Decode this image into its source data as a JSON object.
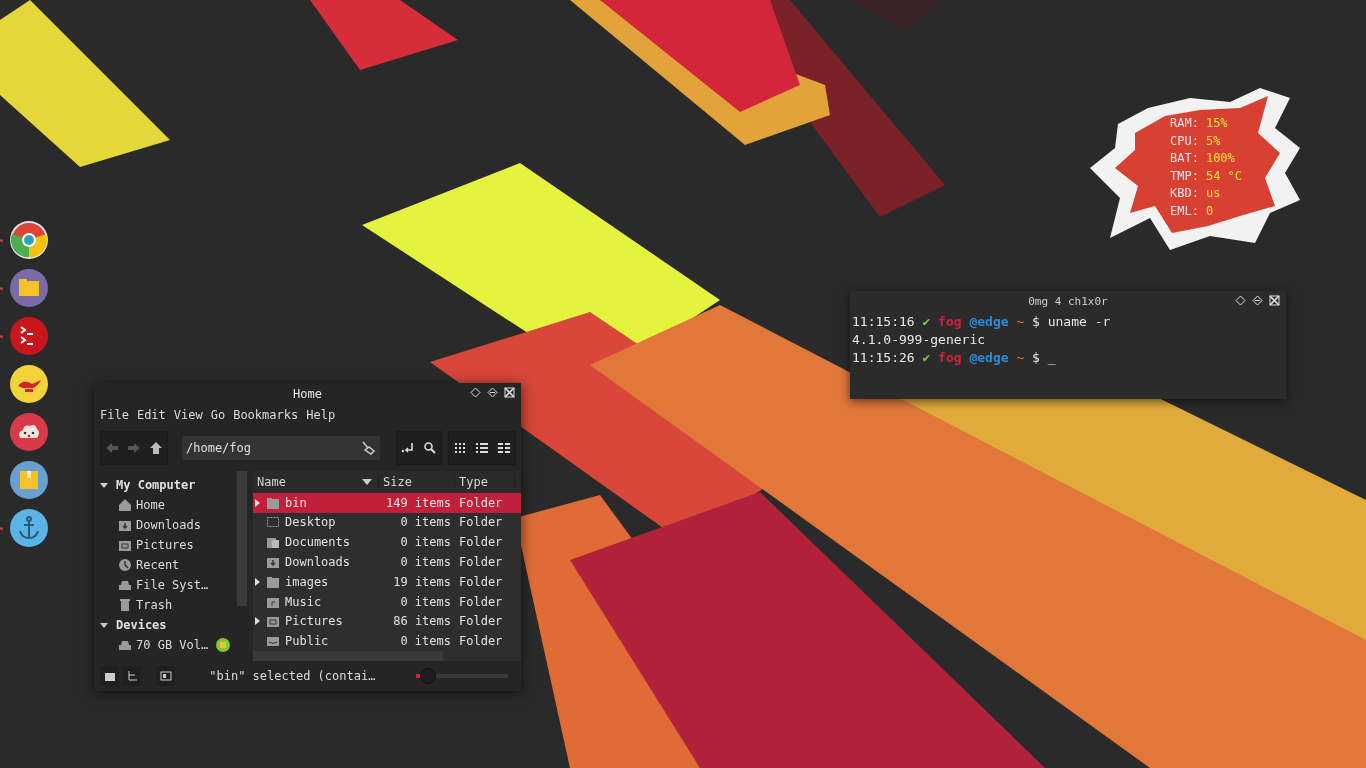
{
  "dock": [
    {
      "kind": "browser",
      "running": true
    },
    {
      "kind": "files",
      "running": true
    },
    {
      "kind": "terminal",
      "running": true
    },
    {
      "kind": "lamp",
      "running": false
    },
    {
      "kind": "cloud",
      "running": false
    },
    {
      "kind": "package",
      "running": false
    },
    {
      "kind": "anchor",
      "running": true
    }
  ],
  "system_monitor": [
    {
      "label": "RAM:",
      "value": "15%"
    },
    {
      "label": "CPU:",
      "value": "5%"
    },
    {
      "label": "BAT:",
      "value": "100%"
    },
    {
      "label": "TMP:",
      "value": "54 °C"
    },
    {
      "label": "KBD:",
      "value": "us"
    },
    {
      "label": "EML:",
      "value": "0"
    }
  ],
  "terminal": {
    "title": "0mg 4 ch1x0r",
    "lines": [
      {
        "kind": "prompt",
        "time": "11:15:16",
        "check": "✔",
        "user": "fog",
        "host": "@edge",
        "path": "~",
        "symbol": "$",
        "command": "uname -r"
      },
      {
        "kind": "output",
        "text": "4.1.0-999-generic"
      },
      {
        "kind": "prompt",
        "time": "11:15:26",
        "check": "✔",
        "user": "fog",
        "host": "@edge",
        "path": "~",
        "symbol": "$",
        "command": "_"
      }
    ]
  },
  "file_manager": {
    "title": "Home",
    "menu": [
      "File",
      "Edit",
      "View",
      "Go",
      "Bookmarks",
      "Help"
    ],
    "location": "/home/fog",
    "sidebar": [
      {
        "heading": "My Computer",
        "expanded": true,
        "items": [
          {
            "label": "Home",
            "kind": "home"
          },
          {
            "label": "Downloads",
            "kind": "download"
          },
          {
            "label": "Pictures",
            "kind": "picture"
          },
          {
            "label": "Recent",
            "kind": "recent"
          },
          {
            "label": "File Syst…",
            "kind": "drive"
          },
          {
            "label": "Trash",
            "kind": "trash"
          }
        ]
      },
      {
        "heading": "Devices",
        "expanded": true,
        "items": [
          {
            "label": "70 GB Vol…",
            "kind": "drive"
          }
        ]
      }
    ],
    "columns": [
      "Name",
      "Size",
      "Type"
    ],
    "rows": [
      {
        "name": "bin",
        "size": "149 items",
        "type": "Folder",
        "selected": true,
        "expandable": true,
        "kind": "folder"
      },
      {
        "name": "Desktop",
        "size": "0 items",
        "type": "Folder",
        "selected": false,
        "expandable": false,
        "kind": "desktop"
      },
      {
        "name": "Documents",
        "size": "0 items",
        "type": "Folder",
        "selected": false,
        "expandable": false,
        "kind": "documents"
      },
      {
        "name": "Downloads",
        "size": "0 items",
        "type": "Folder",
        "selected": false,
        "expandable": false,
        "kind": "download"
      },
      {
        "name": "images",
        "size": "19 items",
        "type": "Folder",
        "selected": false,
        "expandable": true,
        "kind": "folder"
      },
      {
        "name": "Music",
        "size": "0 items",
        "type": "Folder",
        "selected": false,
        "expandable": false,
        "kind": "music"
      },
      {
        "name": "Pictures",
        "size": "86 items",
        "type": "Folder",
        "selected": false,
        "expandable": true,
        "kind": "picture"
      },
      {
        "name": "Public",
        "size": "0 items",
        "type": "Folder",
        "selected": false,
        "expandable": false,
        "kind": "public"
      }
    ],
    "status": "\"bin\" selected (contai…",
    "zoom": {
      "level": 0.12
    }
  }
}
